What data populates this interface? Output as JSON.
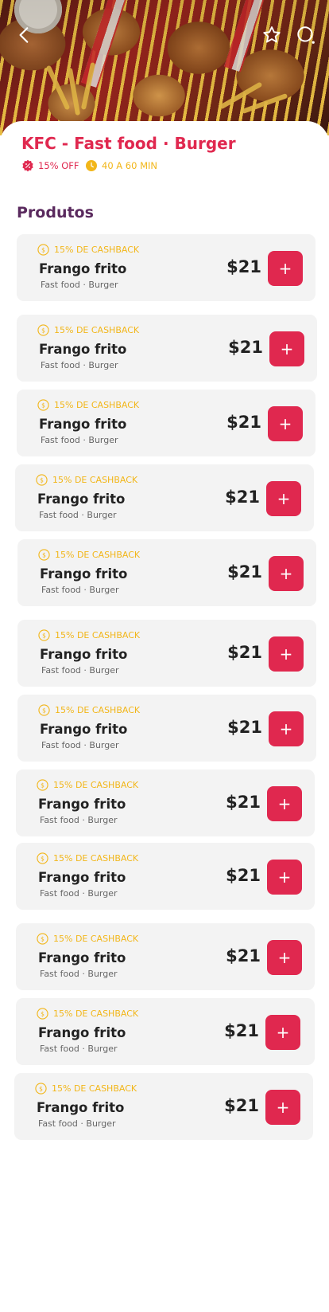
{
  "header": {
    "back_icon": "chevron-left-icon",
    "favorite_icon": "star-icon",
    "search_icon": "search-icon"
  },
  "store": {
    "name": "KFC - Fast food · Burger",
    "discount": "15% OFF",
    "delivery_time": "40 A 60 MIN"
  },
  "section": {
    "title": "Produtos"
  },
  "colors": {
    "accent": "#e0284f",
    "gold": "#f2b619",
    "section_title": "#5a2a5e",
    "card_bg": "#f3f3f3"
  },
  "products": [
    {
      "cashback": "15% DE CASHBACK",
      "name": "Frango frito",
      "category": "Fast food · Burger",
      "price": "$21",
      "add_label": "+"
    },
    {
      "cashback": "15% DE CASHBACK",
      "name": "Frango frito",
      "category": "Fast food · Burger",
      "price": "$21",
      "add_label": "+"
    },
    {
      "cashback": "15% DE CASHBACK",
      "name": "Frango frito",
      "category": "Fast food · Burger",
      "price": "$21",
      "add_label": "+"
    },
    {
      "cashback": "15% DE CASHBACK",
      "name": "Frango frito",
      "category": "Fast food · Burger",
      "price": "$21",
      "add_label": "+"
    },
    {
      "cashback": "15% DE CASHBACK",
      "name": "Frango frito",
      "category": "Fast food · Burger",
      "price": "$21",
      "add_label": "+"
    },
    {
      "cashback": "15% DE CASHBACK",
      "name": "Frango frito",
      "category": "Fast food · Burger",
      "price": "$21",
      "add_label": "+"
    },
    {
      "cashback": "15% DE CASHBACK",
      "name": "Frango frito",
      "category": "Fast food · Burger",
      "price": "$21",
      "add_label": "+"
    },
    {
      "cashback": "15% DE CASHBACK",
      "name": "Frango frito",
      "category": "Fast food · Burger",
      "price": "$21",
      "add_label": "+"
    },
    {
      "cashback": "15% DE CASHBACK",
      "name": "Frango frito",
      "category": "Fast food · Burger",
      "price": "$21",
      "add_label": "+"
    },
    {
      "cashback": "15% DE CASHBACK",
      "name": "Frango frito",
      "category": "Fast food · Burger",
      "price": "$21",
      "add_label": "+"
    },
    {
      "cashback": "15% DE CASHBACK",
      "name": "Frango frito",
      "category": "Fast food · Burger",
      "price": "$21",
      "add_label": "+"
    },
    {
      "cashback": "15% DE CASHBACK",
      "name": "Frango frito",
      "category": "Fast food · Burger",
      "price": "$21",
      "add_label": "+"
    }
  ]
}
